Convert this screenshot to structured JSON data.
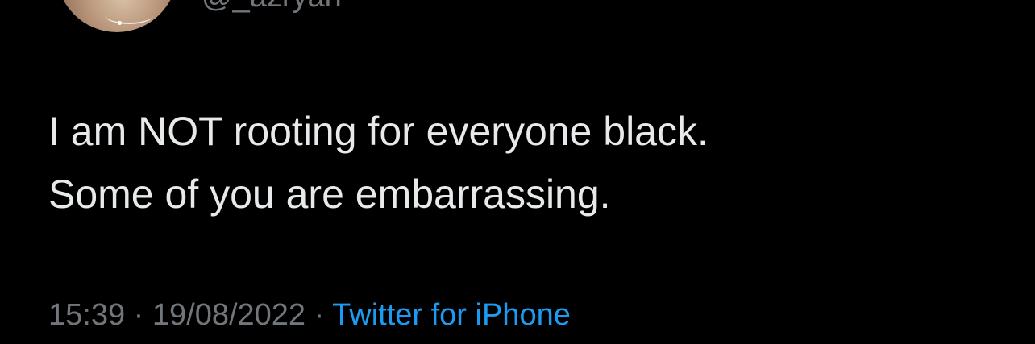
{
  "author": {
    "handle": "@_azryan"
  },
  "tweet": {
    "text": "I am NOT rooting for everyone black.\nSome of you are embarrassing."
  },
  "meta": {
    "time": "15:39",
    "separator": " · ",
    "date": "19/08/2022",
    "source": "Twitter for iPhone"
  },
  "colors": {
    "background": "#000000",
    "text": "#e7e9ea",
    "secondary": "#71767b",
    "link": "#1d9bf0"
  }
}
